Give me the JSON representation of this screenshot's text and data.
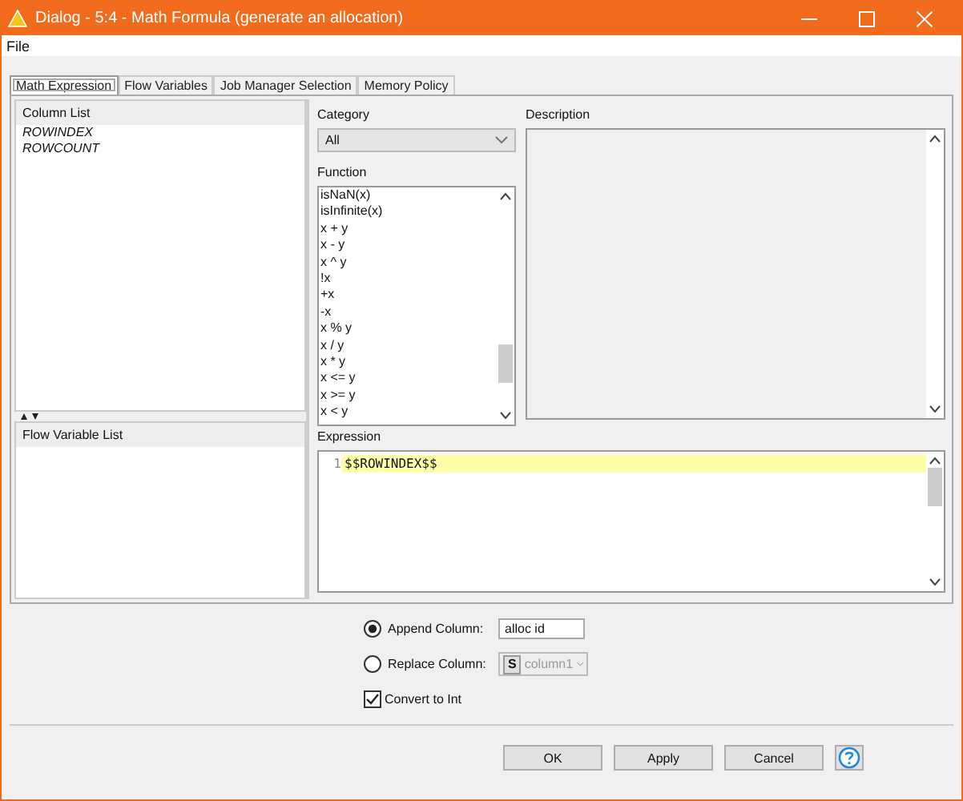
{
  "window": {
    "title": "Dialog - 5:4 - Math Formula (generate an allocation)"
  },
  "menu": [
    "File"
  ],
  "tabs": [
    {
      "label": "Math Expression",
      "selected": true
    },
    {
      "label": "Flow Variables",
      "selected": false
    },
    {
      "label": "Job Manager Selection",
      "selected": false
    },
    {
      "label": "Memory Policy",
      "selected": false
    }
  ],
  "column_list": {
    "title": "Column List",
    "items": [
      "ROWINDEX",
      "ROWCOUNT"
    ]
  },
  "flow_variable_list": {
    "title": "Flow Variable List"
  },
  "category": {
    "label": "Category",
    "value": "All"
  },
  "function": {
    "label": "Function",
    "items": [
      "isNaN(x)",
      "isInfinite(x)",
      "x + y",
      "x - y",
      "x ^ y",
      "!x",
      "+x",
      "-x",
      "x % y",
      "x / y",
      "x * y",
      "x <= y",
      "x >= y",
      "x < y"
    ]
  },
  "description": {
    "label": "Description"
  },
  "expression": {
    "label": "Expression",
    "lines": [
      {
        "number": "1",
        "text": "$$ROWINDEX$$"
      }
    ]
  },
  "options": [
    {
      "kind": "radio",
      "label": "Append Column:",
      "selected": true,
      "value": "alloc id",
      "disabled": false
    },
    {
      "kind": "radio",
      "label": "Replace Column:",
      "selected": false,
      "type_badge": "S",
      "value": "column1",
      "disabled": true
    },
    {
      "kind": "checkbox",
      "label": "Convert to Int",
      "checked": true
    }
  ],
  "buttons": [
    {
      "kind": "text",
      "label": "OK"
    },
    {
      "kind": "text",
      "label": "Apply"
    },
    {
      "kind": "text",
      "label": "Cancel"
    },
    {
      "kind": "help"
    }
  ]
}
